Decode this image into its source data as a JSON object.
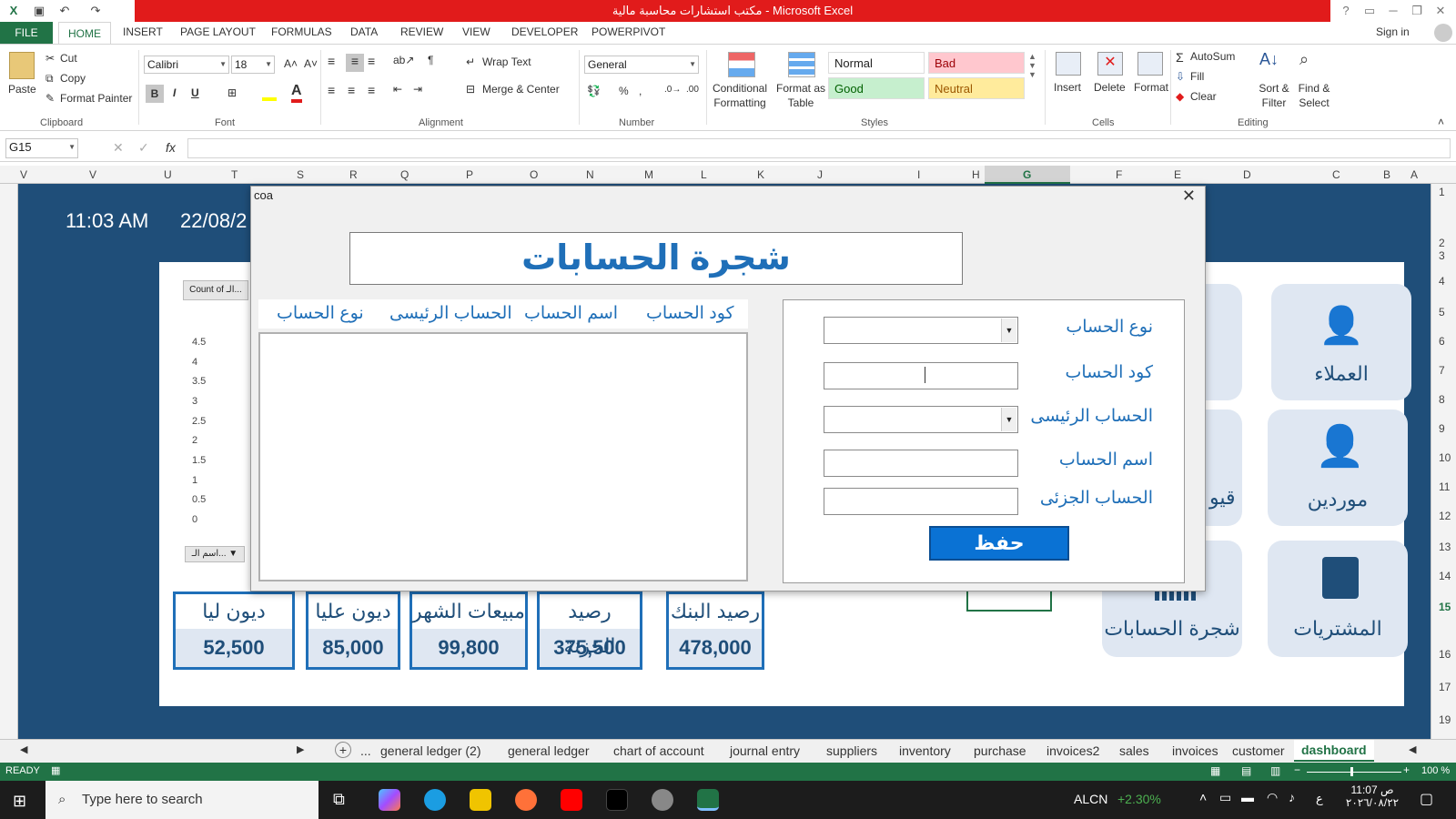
{
  "window": {
    "title": "مكتب استشارات محاسبة مالية - Microsoft Excel",
    "controls": [
      "?",
      "▭",
      "─",
      "❐",
      "✕"
    ]
  },
  "ribbon_tabs": [
    "FILE",
    "HOME",
    "INSERT",
    "PAGE LAYOUT",
    "FORMULAS",
    "DATA",
    "REVIEW",
    "VIEW",
    "DEVELOPER",
    "POWERPIVOT"
  ],
  "signin": "Sign in",
  "clipboard": {
    "paste": "Paste",
    "cut": "Cut",
    "copy": "Copy",
    "format_painter": "Format Painter",
    "group": "Clipboard"
  },
  "font": {
    "name": "Calibri",
    "size": "18",
    "group": "Font",
    "bold": "B",
    "italic": "I",
    "underline": "U"
  },
  "alignment": {
    "wrap": "Wrap Text",
    "merge": "Merge & Center",
    "group": "Alignment"
  },
  "number": {
    "format": "General",
    "group": "Number",
    "percent": "%"
  },
  "styles": {
    "conditional": "Conditional Formatting",
    "format_table": "Format as Table",
    "normal": "Normal",
    "bad": "Bad",
    "good": "Good",
    "neutral": "Neutral",
    "group": "Styles",
    "colors": {
      "normal": "#ffffff",
      "bad": "#ffc7ce",
      "good": "#c6efce",
      "neutral": "#ffeb9c"
    }
  },
  "cells": {
    "insert": "Insert",
    "delete": "Delete",
    "format": "Format",
    "group": "Cells"
  },
  "editing": {
    "autosum": "AutoSum",
    "fill": "Fill",
    "clear": "Clear",
    "sort": "Sort & Filter",
    "find": "Find & Select",
    "group": "Editing"
  },
  "formula_bar": {
    "name_box": "G15",
    "fx": "fx",
    "value": ""
  },
  "columns": [
    "V",
    "U",
    "T",
    "S",
    "R",
    "Q",
    "P",
    "O",
    "N",
    "M",
    "L",
    "K",
    "J",
    "I",
    "H",
    "G",
    "F",
    "E",
    "D",
    "C",
    "B",
    "A"
  ],
  "rows": [
    "1",
    "2",
    "3",
    "4",
    "5",
    "6",
    "7",
    "8",
    "9",
    "10",
    "11",
    "12",
    "13",
    "14",
    "15",
    "16",
    "17",
    "19"
  ],
  "dashboard": {
    "time": "11:03 AM",
    "date": "22/08/2",
    "chart_button": "Count of الـ...",
    "chart_filter": "اسم الـ...",
    "y_ticks": [
      "4.5",
      "4",
      "3.5",
      "3",
      "2.5",
      "2",
      "1.5",
      "1",
      "0.5",
      "0"
    ],
    "cards": [
      {
        "label": "العملاء",
        "icon": "user-list-icon"
      },
      {
        "label": "موردين",
        "icon": "user-add-icon"
      },
      {
        "label": "المشتريات",
        "icon": "shopping-bag-icon"
      },
      {
        "label": "شجرة الحسابات",
        "icon": "calendar-grid-icon"
      },
      {
        "label": "قيو",
        "icon": ""
      }
    ],
    "kpis": [
      {
        "title": "رصيد البنك",
        "value": "478,000"
      },
      {
        "title": "رصيد الخزنة",
        "value": "375,500"
      },
      {
        "title": "مبيعات الشهر",
        "value": "99,800"
      },
      {
        "title": "ديون عليا",
        "value": "85,000"
      },
      {
        "title": "ديون ليا",
        "value": "52,500"
      }
    ]
  },
  "dialog": {
    "title": "coa",
    "close": "✕",
    "header": "شجرة الحسابات",
    "list_columns": [
      "كود الحساب",
      "اسم الحساب",
      "الحساب الرئيسى",
      "نوع الحساب"
    ],
    "fields": {
      "account_type": "نوع الحساب",
      "account_code": "كود الحساب",
      "parent_account": "الحساب الرئيسى",
      "account_name": "اسم الحساب",
      "sub_account": "الحساب الجزئى"
    },
    "save": "حفظ"
  },
  "sheet_tabs": [
    "...",
    "general ledger (2)",
    "general ledger",
    "chart of account",
    "journal entry",
    "suppliers",
    "inventory",
    "purchase",
    "invoices2",
    "sales",
    "invoices",
    "customer",
    "dashboard"
  ],
  "status": {
    "ready": "READY",
    "zoom": "100 %"
  },
  "taskbar": {
    "search": "Type here to search",
    "ticker": "ALCN",
    "ticker_change": "+2.30%",
    "time": "11:07 ص",
    "date": "٢٠٢٦/٠٨/٢٢",
    "lang": "ع"
  }
}
